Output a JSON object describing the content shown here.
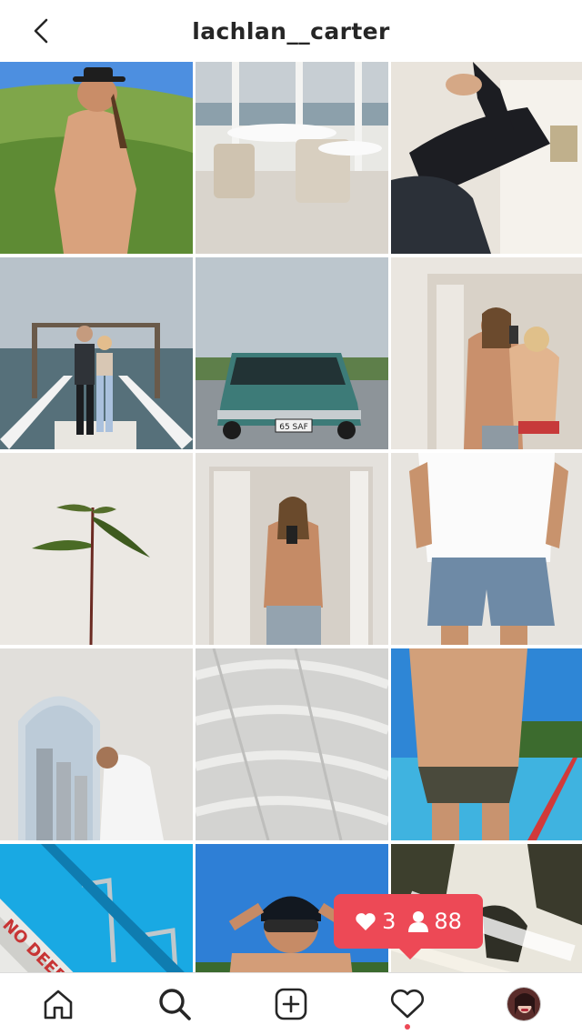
{
  "header": {
    "username": "lachlan__carter",
    "back_icon": "chevron-left-icon"
  },
  "grid": {
    "tiles": [
      "shirtless man in black hat on grassy hill",
      "white chairs and table facing marina",
      "legs in black jeans on white chair",
      "couple standing on pier over water",
      "vintage teal station wagon parked",
      "couple taking mirror selfie",
      "young mango seedling against white wall",
      "man taking mirror selfie in doorway",
      "man in white t-shirt and denim shorts",
      "man looking out arched window at city",
      "white embossed textured fabric",
      "man in swim briefs by outdoor pool",
      "pool edge with ladder and DEEP WATER sign",
      "man adjusting swim goggles",
      "rocky waterfall rapids"
    ]
  },
  "notification": {
    "likes_count": "3",
    "followers_count": "88",
    "likes_icon": "heart-icon",
    "followers_icon": "person-icon"
  },
  "pool_sign": "NO DEEP WATER",
  "car_plate": "65 SAF",
  "nav": {
    "items": [
      "home-icon",
      "search-icon",
      "add-post-icon",
      "activity-heart-icon",
      "profile-avatar"
    ]
  },
  "colors": {
    "badge": "#ed4956",
    "text": "#262626"
  }
}
